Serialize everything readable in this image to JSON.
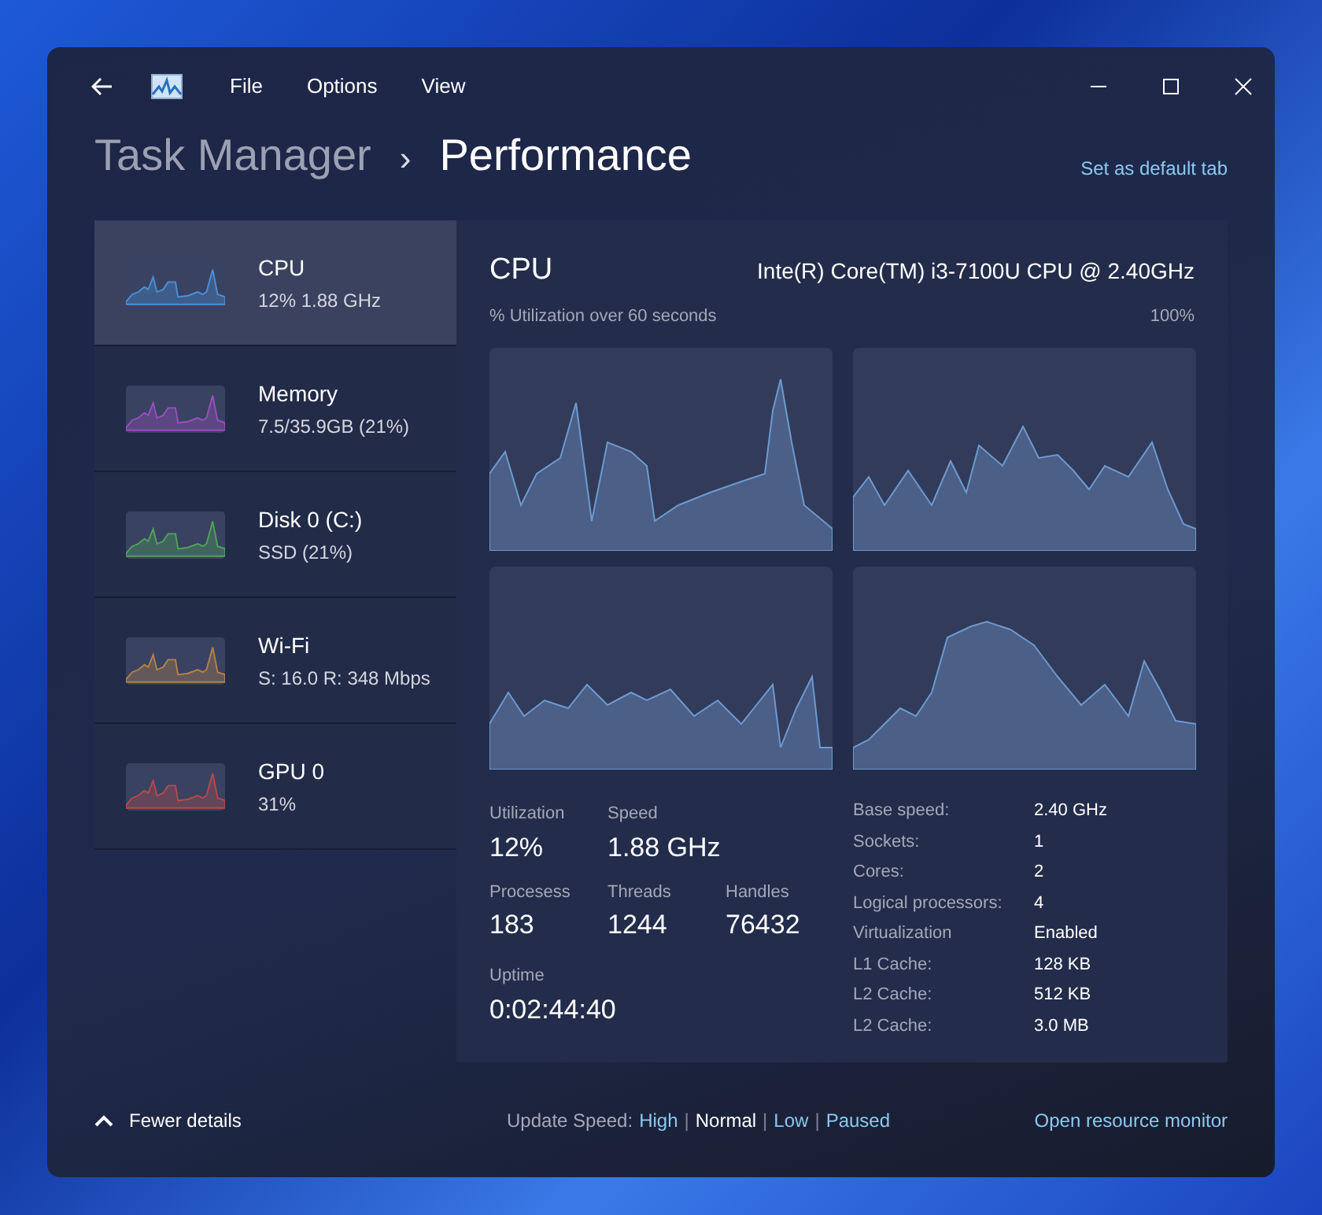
{
  "menu": [
    "File",
    "Options",
    "View"
  ],
  "breadcrumb": {
    "parent": "Task Manager",
    "separator": "›",
    "current": "Performance"
  },
  "default_tab_link": "Set as default tab",
  "sidebar": {
    "items": [
      {
        "name": "CPU",
        "detail": "12% 1.88 GHz",
        "color": "#4a90d9",
        "selected": true
      },
      {
        "name": "Memory",
        "detail": "7.5/35.9GB (21%)",
        "color": "#9b4fc0",
        "selected": false
      },
      {
        "name": "Disk 0 (C:)",
        "detail": "SSD (21%)",
        "color": "#4fa35a",
        "selected": false
      },
      {
        "name": "Wi-Fi",
        "detail": "S: 16.0 R: 348 Mbps",
        "color": "#b5824a",
        "selected": false
      },
      {
        "name": "GPU 0",
        "detail": "31%",
        "color": "#b54a4a",
        "selected": false
      }
    ]
  },
  "panel": {
    "title": "CPU",
    "model": "Inte(R) Core(TM) i3-7100U CPU @ 2.40GHz",
    "graph_caption": "% Utilization over 60 seconds",
    "graph_max": "100%",
    "stats": [
      [
        {
          "label": "Utilization",
          "value": "12%"
        },
        {
          "label": "Speed",
          "value": "1.88 GHz"
        }
      ],
      [
        {
          "label": "Procesess",
          "value": "183"
        },
        {
          "label": "Threads",
          "value": "1244"
        },
        {
          "label": "Handles",
          "value": "76432"
        }
      ],
      [
        {
          "label": "Uptime",
          "value": "0:02:44:40"
        }
      ]
    ],
    "specs": [
      {
        "label": "Base speed:",
        "value": "2.40 GHz"
      },
      {
        "label": "Sockets:",
        "value": "1"
      },
      {
        "label": "Cores:",
        "value": "2"
      },
      {
        "label": "Logical processors:",
        "value": "4"
      },
      {
        "label": "Virtualization",
        "value": "Enabled"
      },
      {
        "label": "L1 Cache:",
        "value": "128 KB"
      },
      {
        "label": "L2 Cache:",
        "value": "512 KB"
      },
      {
        "label": "L2 Cache:",
        "value": "3.0 MB"
      }
    ]
  },
  "footer": {
    "toggle": "Fewer details",
    "update_label": "Update Speed:",
    "speeds": [
      {
        "label": "High",
        "selected": false
      },
      {
        "label": "Normal",
        "selected": true
      },
      {
        "label": "Low",
        "selected": false
      },
      {
        "label": "Paused",
        "selected": false
      }
    ],
    "separator": "|",
    "resource_link": "Open resource monitor"
  }
}
